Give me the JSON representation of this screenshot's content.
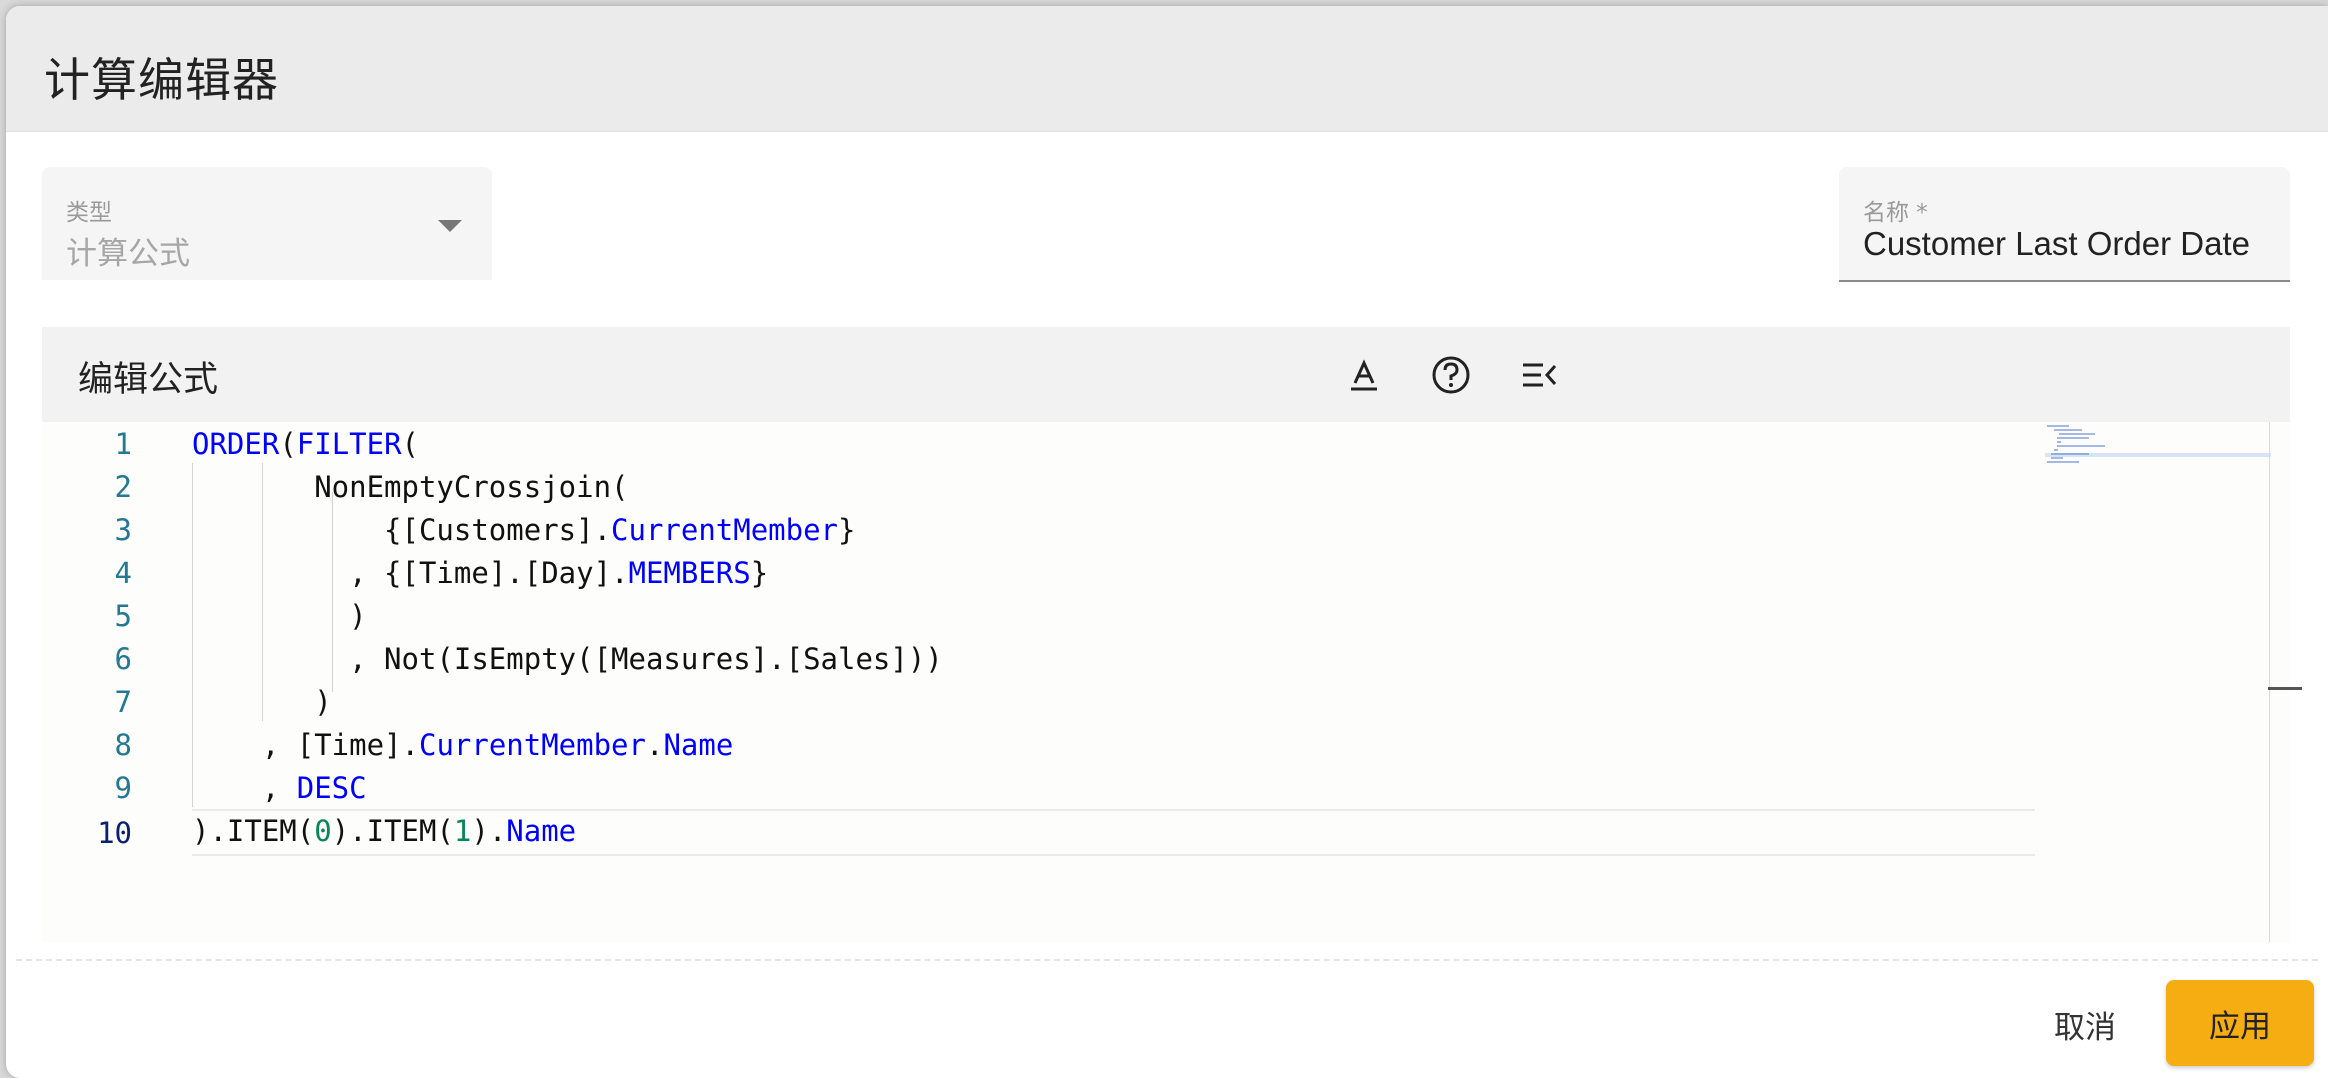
{
  "dialog": {
    "title": "计算编辑器"
  },
  "type_field": {
    "label": "类型",
    "value": "计算公式",
    "icon": "chevron-down-icon"
  },
  "name_field": {
    "label": "名称 *",
    "value": "Customer Last Order Date"
  },
  "editor": {
    "title": "编辑公式",
    "tools": [
      {
        "icon": "text-format-icon"
      },
      {
        "icon": "help-circle-icon"
      },
      {
        "icon": "collapse-lines-icon"
      }
    ],
    "line_numbers": [
      "1",
      "2",
      "3",
      "4",
      "5",
      "6",
      "7",
      "8",
      "9",
      "10"
    ],
    "code_lines": [
      "ORDER(FILTER(",
      "       NonEmptyCrossjoin(",
      "           {[Customers].CurrentMember}",
      "         , {[Time].[Day].MEMBERS}",
      "         )",
      "         , Not(IsEmpty([Measures].[Sales]))",
      "       )",
      "    , [Time].CurrentMember.Name",
      "    , DESC",
      ").ITEM(0).ITEM(1).Name"
    ],
    "current_line": 10
  },
  "footer": {
    "cancel_label": "取消",
    "apply_label": "应用"
  },
  "colors": {
    "keyword": "#0000ff",
    "number": "#098658",
    "line_number": "#237893",
    "apply_button": "#f6ad12"
  }
}
